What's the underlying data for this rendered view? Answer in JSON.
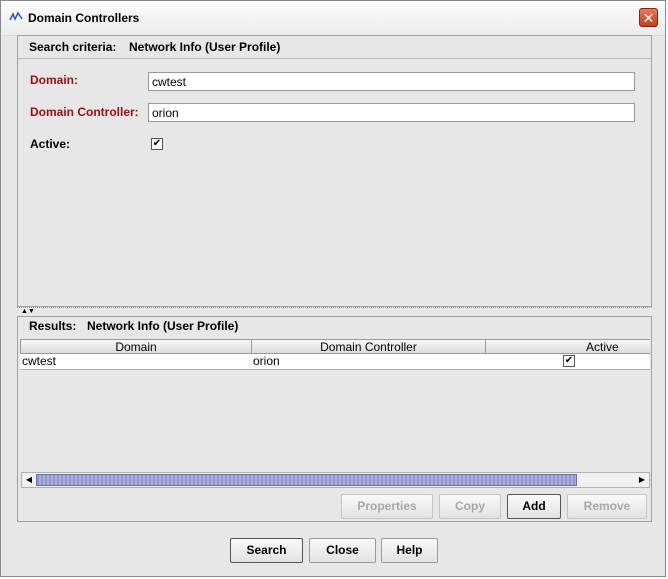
{
  "window": {
    "title": "Domain Controllers",
    "close_label": "✕"
  },
  "criteria": {
    "label": "Search criteria:",
    "value": "Network Info (User Profile)",
    "fields": {
      "domain_label": "Domain:",
      "domain_value": "cwtest",
      "dc_label": "Domain Controller:",
      "dc_value": "orion",
      "active_label": "Active:",
      "active_checked": "✔"
    }
  },
  "results": {
    "label": "Results:",
    "value": "Network Info (User Profile)",
    "columns": [
      "Domain",
      "Domain Controller",
      "Active"
    ],
    "rows": [
      {
        "domain": "cwtest",
        "dc": "orion",
        "active": "✔"
      }
    ]
  },
  "result_buttons": {
    "properties": "Properties",
    "copy": "Copy",
    "add": "Add",
    "remove": "Remove"
  },
  "bottom_buttons": {
    "search": "Search",
    "close": "Close",
    "help": "Help"
  }
}
